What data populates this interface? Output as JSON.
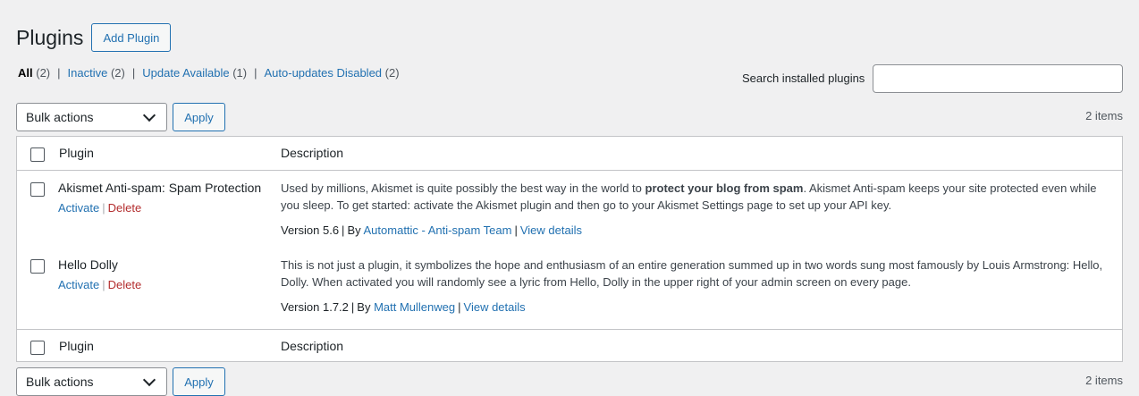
{
  "header": {
    "title": "Plugins",
    "add_button": "Add Plugin"
  },
  "filters": [
    {
      "label": "All",
      "count": "(2)"
    },
    {
      "label": "Inactive",
      "count": "(2)"
    },
    {
      "label": "Update Available",
      "count": "(1)"
    },
    {
      "label": "Auto-updates Disabled",
      "count": "(2)"
    }
  ],
  "search": {
    "label": "Search installed plugins",
    "value": ""
  },
  "bulk": {
    "selected": "Bulk actions",
    "apply": "Apply",
    "items_count": "2 items"
  },
  "table": {
    "col_plugin": "Plugin",
    "col_description": "Description",
    "rows": [
      {
        "name": "Akismet Anti-spam: Spam Protection",
        "activate": "Activate",
        "delete": "Delete",
        "desc_pre": "Used by millions, Akismet is quite possibly the best way in the world to ",
        "desc_bold": "protect your blog from spam",
        "desc_post": ". Akismet Anti-spam keeps your site protected even while you sleep. To get started: activate the Akismet plugin and then go to your Akismet Settings page to set up your API key.",
        "version": "Version 5.6",
        "by": "By",
        "author": "Automattic - Anti-spam Team",
        "details": "View details"
      },
      {
        "name": "Hello Dolly",
        "activate": "Activate",
        "delete": "Delete",
        "desc_pre": "This is not just a plugin, it symbolizes the hope and enthusiasm of an entire generation summed up in two words sung most famously by Louis Armstrong: Hello, Dolly. When activated you will randomly see a lyric from Hello, Dolly in the upper right of your admin screen on every page.",
        "desc_bold": "",
        "desc_post": "",
        "version": "Version 1.7.2",
        "by": "By",
        "author": "Matt Mullenweg",
        "details": "View details"
      }
    ]
  }
}
